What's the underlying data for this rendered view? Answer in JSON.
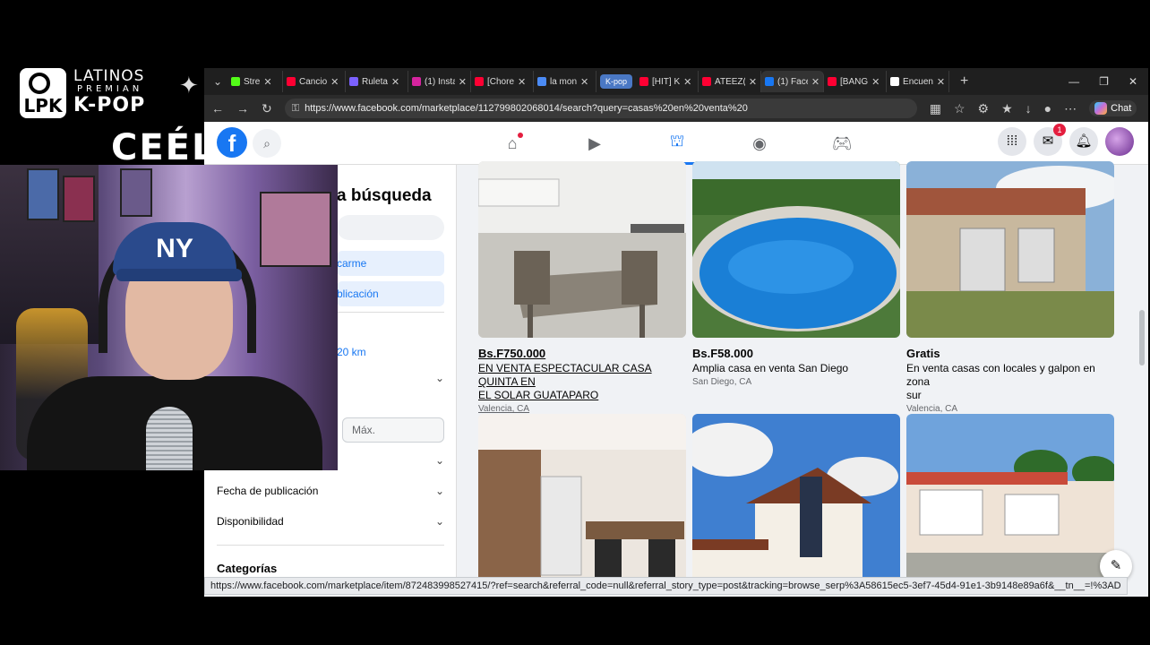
{
  "stream": {
    "logo_badge": "LPK",
    "logo_line1": "LATINOS",
    "logo_line2": "PREMIAN",
    "logo_line3": "K-POP",
    "overlay_text": "CEÉL"
  },
  "browser": {
    "tabs": [
      {
        "label": "Stre",
        "icon": "kick-icon",
        "color": "#53fc18"
      },
      {
        "label": "Cancio",
        "icon": "youtube-icon",
        "color": "#ff0033"
      },
      {
        "label": "Ruleta",
        "icon": "wheel-icon",
        "color": "#7b61ff"
      },
      {
        "label": "(1) Insta",
        "icon": "instagram-icon",
        "color": "#d6249f"
      },
      {
        "label": "[Chore",
        "icon": "youtube-icon",
        "color": "#ff0033"
      },
      {
        "label": "la mon",
        "icon": "search-icon",
        "color": "#4b8bf5"
      },
      {
        "label": "[HIT] K",
        "icon": "youtube-icon",
        "color": "#ff0033"
      },
      {
        "label": "ATEEZ(",
        "icon": "youtube-icon",
        "color": "#ff0033"
      },
      {
        "label": "(1) Face",
        "icon": "facebook-icon",
        "color": "#1877f2"
      },
      {
        "label": "[BANG",
        "icon": "youtube-icon",
        "color": "#ff0033"
      },
      {
        "label": "Encuen",
        "icon": "tiktok-icon",
        "color": "#ffffff"
      }
    ],
    "tab_group_label": "K-pop",
    "url": "https://www.facebook.com/marketplace/112799802068014/search?query=casas%20en%20venta%20",
    "chat_label": "Chat",
    "status_url": "https://www.facebook.com/marketplace/item/872483998527415/?ref=search&referral_code=null&referral_story_type=post&tracking=browse_serp%3A58615ec5-3ef7-45d4-91e1-3b9148e89a6f&__tn__=!%3AD"
  },
  "facebook": {
    "logo": "f",
    "messenger_badge": "1",
    "sidebar": {
      "title": "a búsqueda",
      "link1": "carme",
      "link2": "blicación",
      "radius": "20 km",
      "max_placeholder": "Máx.",
      "fecha": "Fecha de publicación",
      "disponibilidad": "Disponibilidad",
      "categorias": "Categorías"
    },
    "listings": [
      {
        "price": "Bs.F750.000",
        "title_l1": "EN VENTA ESPECTACULAR CASA QUINTA EN",
        "title_l2": "EL SOLAR GUATAPARO",
        "location": "Valencia, CA"
      },
      {
        "price": "Bs.F58.000",
        "title_l1": "Amplia casa en venta San Diego",
        "title_l2": "",
        "location": "San Diego, CA"
      },
      {
        "price": "Gratis",
        "title_l1": "En venta casas con locales y galpon en zona",
        "title_l2": "sur",
        "location": "Valencia, CA"
      }
    ]
  }
}
